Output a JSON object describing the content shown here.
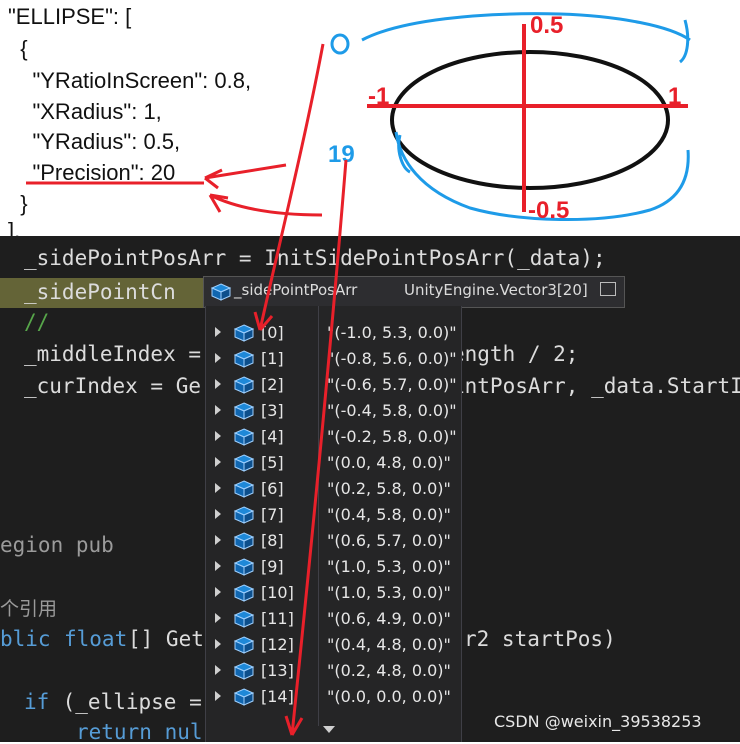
{
  "json_snippet": {
    "lines": [
      "\"ELLIPSE\": [",
      "  {",
      "    \"YRatioInScreen\": 0.8,",
      "    \"XRadius\": 1,",
      "    \"YRadius\": 0.5,",
      "    \"Precision\": 20",
      "  }",
      "],"
    ]
  },
  "annotations": {
    "top_label": "0.5",
    "bottom_label": "-0.5",
    "left_label": "-1",
    "right_label": "1",
    "count_label": "19",
    "zero_label": "0",
    "colors": {
      "red": "#e8202a",
      "blue": "#1e9be8",
      "ellipse": "#111111"
    }
  },
  "code": {
    "line1": "_sidePointPosArr = InitSidePointPosArr(_data);",
    "line2": "_sidePointCn",
    "line3": "//",
    "line4a": "_middleIndex = ",
    "line4b": "ength / 2;",
    "line5a": "_curIndex = Ge",
    "line5b": "intPosArr, _data.StartI",
    "line6": "egion pub",
    "line7": "个引用",
    "line8a": "blic",
    "line8b": "float",
    "line8c": "[] Get",
    "line8d": "r2 startPos)",
    "line9a": "if",
    "line9b": " (_ellipse = ",
    "line10a": "return",
    "line10b": " nul"
  },
  "debugger": {
    "variable_name": "_sidePointPosArr",
    "variable_type": "UnityEngine.Vector3[20]",
    "items": [
      {
        "index": "[0]",
        "value": "\"(-1.0, 5.3, 0.0)\""
      },
      {
        "index": "[1]",
        "value": "\"(-0.8, 5.6, 0.0)\""
      },
      {
        "index": "[2]",
        "value": "\"(-0.6, 5.7, 0.0)\""
      },
      {
        "index": "[3]",
        "value": "\"(-0.4, 5.8, 0.0)\""
      },
      {
        "index": "[4]",
        "value": "\"(-0.2, 5.8, 0.0)\""
      },
      {
        "index": "[5]",
        "value": "\"(0.0, 4.8, 0.0)\""
      },
      {
        "index": "[6]",
        "value": "\"(0.2, 5.8, 0.0)\""
      },
      {
        "index": "[7]",
        "value": "\"(0.4, 5.8, 0.0)\""
      },
      {
        "index": "[8]",
        "value": "\"(0.6, 5.7, 0.0)\""
      },
      {
        "index": "[9]",
        "value": "\"(1.0, 5.3, 0.0)\""
      },
      {
        "index": "[10]",
        "value": "\"(1.0, 5.3, 0.0)\""
      },
      {
        "index": "[11]",
        "value": "\"(0.6, 4.9, 0.0)\""
      },
      {
        "index": "[12]",
        "value": "\"(0.4, 4.8, 0.0)\""
      },
      {
        "index": "[13]",
        "value": "\"(0.2, 4.8, 0.0)\""
      },
      {
        "index": "[14]",
        "value": "\"(0.0, 0.0, 0.0)\""
      }
    ]
  },
  "watermark": "CSDN @weixin_39538253"
}
